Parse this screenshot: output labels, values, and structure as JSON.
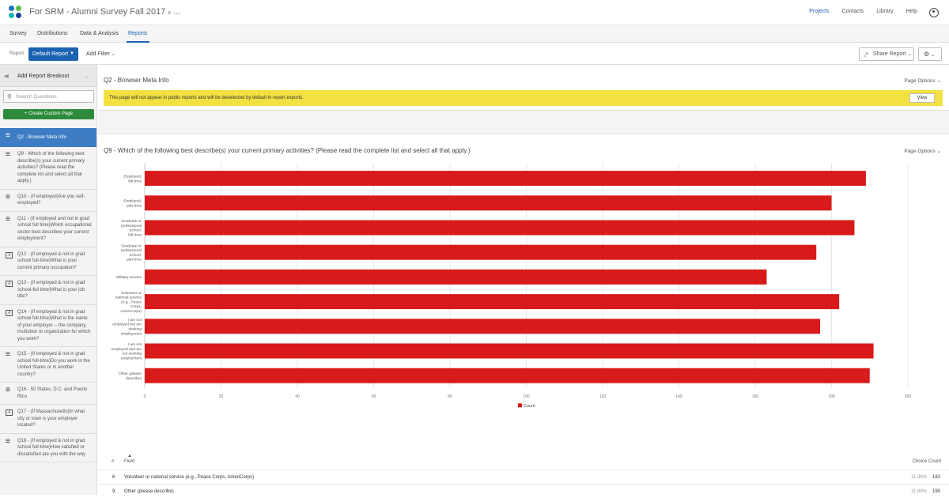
{
  "app": {
    "project_title": "For SRM - Alumni Survey Fall 2017 - ...",
    "nav": [
      "Projects",
      "Contacts",
      "Library",
      "Help"
    ],
    "active_nav": "Projects",
    "logo_colors": [
      "#1b75bb",
      "#5aba47",
      "#17b3b0",
      "#1b3f8f"
    ]
  },
  "tabs": [
    "Survey",
    "Distributions",
    "Data & Analysis",
    "Reports"
  ],
  "active_tab": "Reports",
  "toolbar": {
    "report_label": "Report:",
    "report_button": "Default Report",
    "add_filter": "Add Filter",
    "share_report": "Share Report"
  },
  "sidebar": {
    "breakout_label": "Add Report Breakout",
    "search_placeholder": "Search Questions",
    "create_button": "Create Custom Page",
    "questions": [
      {
        "label": "Q2 - Browser Meta Info",
        "icon": "list-icon",
        "active": true
      },
      {
        "label": "Q9 - Which of the following best describe(s) your current primary activities? (Please read the complete list and select all that apply.)",
        "icon": "list-icon"
      },
      {
        "label": "Q10 - (If employed)Are you self-employed?",
        "icon": "list-icon"
      },
      {
        "label": "Q11 - (If employed and not in grad school full time)Which occupational sector best describes your current employment?",
        "icon": "list-icon"
      },
      {
        "label": "Q12 - (If employed & not in grad school full-time)What is your current primary occupation?",
        "icon": "text-entry-icon"
      },
      {
        "label": "Q13 - (If employed & not in grad school-full time)What is your job title?",
        "icon": "text-entry-icon"
      },
      {
        "label": "Q14 - (If employed & not in grad school full-time)What is the name of your employer -- the company, institution or organization for which you work?",
        "icon": "text-entry-icon"
      },
      {
        "label": "Q15 - (If employed & not in grad school full-time)Do you work in the United States or in another country?",
        "icon": "list-icon"
      },
      {
        "label": "Q16 - 50 States, D.C. and Puerto Rico",
        "icon": "list-icon"
      },
      {
        "label": "Q17 - (If Massachusetts)In what city or town is your employer located?",
        "icon": "text-entry-icon"
      },
      {
        "label": "Q18 - (If employed & not in grad school full-time)How satisfied or dissatisfied are you with the way",
        "icon": "list-icon"
      }
    ]
  },
  "q2": {
    "title": "Q2 - Browser Meta Info",
    "page_options": "Page Options",
    "warning": "This page will not appear in public reports and will be deselected by default in report exports.",
    "view_button": "View"
  },
  "q9": {
    "title": "Q9 - Which of the following best describe(s) your current primary activities? (Please read the complete list and select all that apply.)",
    "page_options": "Page Options"
  },
  "chart_data": {
    "type": "bar",
    "orientation": "horizontal",
    "categories": [
      "Employed, full-time",
      "Employed, part-time",
      "Graduate or professional school, full-time",
      "Graduate or professional school, part-time",
      "Military service",
      "Volunteer or national service (e.g., Peace Corps, AmeriCorps)",
      "I am not employed but am seeking employment",
      "I am not employed and am not seeking employment",
      "Other (please describe)"
    ],
    "series": [
      {
        "name": "Count",
        "color": "#d91a1a",
        "values": [
          189,
          180,
          186,
          176,
          163,
          182,
          177,
          191,
          190
        ]
      }
    ],
    "xlim": [
      0,
      200
    ],
    "xticks": [
      0,
      20,
      40,
      60,
      80,
      100,
      120,
      140,
      160,
      180,
      200
    ],
    "grid": true,
    "legend": "bottom"
  },
  "table": {
    "headers": {
      "hash": "#",
      "field": "Field",
      "choice_count": "Choice Count"
    },
    "rows": [
      {
        "num": "6",
        "field": "Volunteer or national service (e.g., Peace Corps, AmeriCorps)",
        "pct": "11.38%",
        "count": "182"
      },
      {
        "num": "9",
        "field": "Other (please describe)",
        "pct": "11.88%",
        "count": "190"
      }
    ]
  }
}
